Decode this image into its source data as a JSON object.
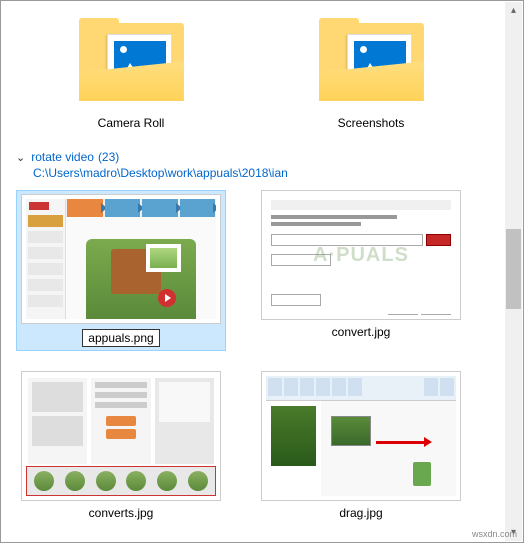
{
  "folders": {
    "camera": "Camera Roll",
    "screenshots": "Screenshots"
  },
  "group": {
    "name": "rotate video",
    "count": "(23)",
    "path": "C:\\Users\\madro\\Desktop\\work\\appuals\\2018\\ian"
  },
  "files": {
    "appuals": "appuals.png",
    "convert": "convert.jpg",
    "converts": "converts.jpg",
    "drag": "drag.jpg"
  },
  "watermark": "wsxdn.com"
}
